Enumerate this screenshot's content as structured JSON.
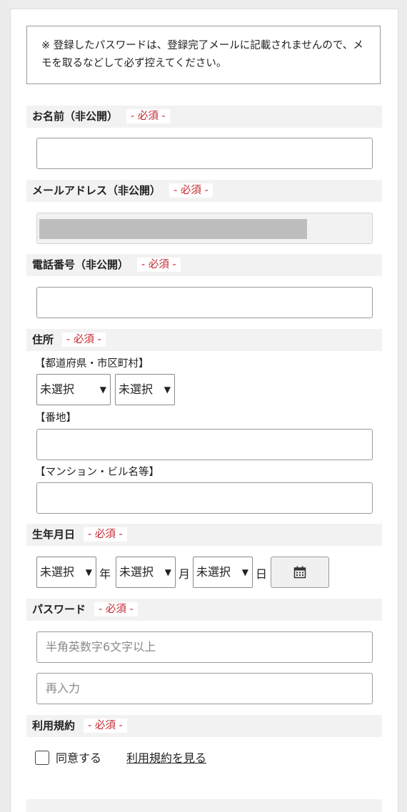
{
  "notice": "※ 登録したパスワードは、登録完了メールに記載されませんので、メモを取るなどして必ず控えてください。",
  "required_label": "- 必須 -",
  "sections": {
    "name": "お名前（非公開）",
    "email": "メールアドレス（非公開）",
    "phone": "電話番号（非公開）",
    "address": "住所",
    "birthday": "生年月日",
    "password": "パスワード",
    "terms": "利用規約"
  },
  "address": {
    "pref_label": "【都道府県・市区町村】",
    "pref_value": "未選択",
    "city_value": "未選択",
    "banchi_label": "【番地】",
    "building_label": "【マンション・ビル名等】"
  },
  "birthday": {
    "year_value": "未選択",
    "year_unit": "年",
    "month_value": "未選択",
    "month_unit": "月",
    "day_value": "未選択",
    "day_unit": "日"
  },
  "password": {
    "placeholder": "半角英数字6文字以上",
    "confirm_placeholder": "再入力"
  },
  "terms": {
    "agree_label": "同意する",
    "link_label": "利用規約を見る"
  },
  "select_arrow": "▼",
  "icons": {
    "calendar": "calendar-icon",
    "dropdown": "chevron-down-icon"
  }
}
